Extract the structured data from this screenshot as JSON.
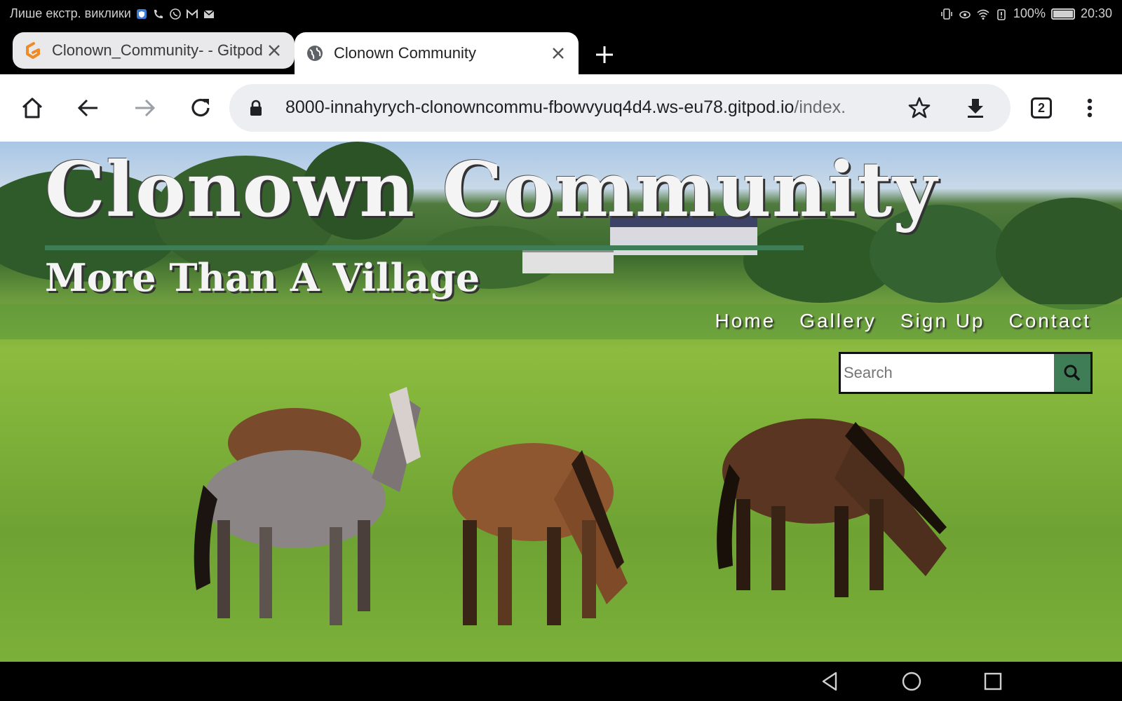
{
  "status_bar": {
    "carrier_text": "Лише екстр. виклики",
    "battery": "100%",
    "time": "20:30"
  },
  "tabs": [
    {
      "title": "Clonown_Community- - Gitpod",
      "active": false
    },
    {
      "title": "Clonown Community",
      "active": true
    }
  ],
  "toolbar": {
    "url_host": "8000-innahyrych-clonowncommu-fbowvyuq4d4.ws-eu78.gitpod.io",
    "url_path": "/index.",
    "tab_count": "2"
  },
  "site": {
    "title": "Clonown Community",
    "tagline": "More Than A Village",
    "nav": [
      "Home",
      "Gallery",
      "Sign Up",
      "Contact"
    ],
    "search_placeholder": "Search"
  },
  "colors": {
    "accent": "#3f7d57"
  },
  "icons": {
    "home": "home-icon",
    "back": "arrow-left-icon",
    "forward": "arrow-right-icon",
    "reload": "reload-icon",
    "lock": "lock-icon",
    "star": "star-icon",
    "download": "download-icon",
    "menu": "more-vert-icon",
    "search": "search-icon"
  }
}
